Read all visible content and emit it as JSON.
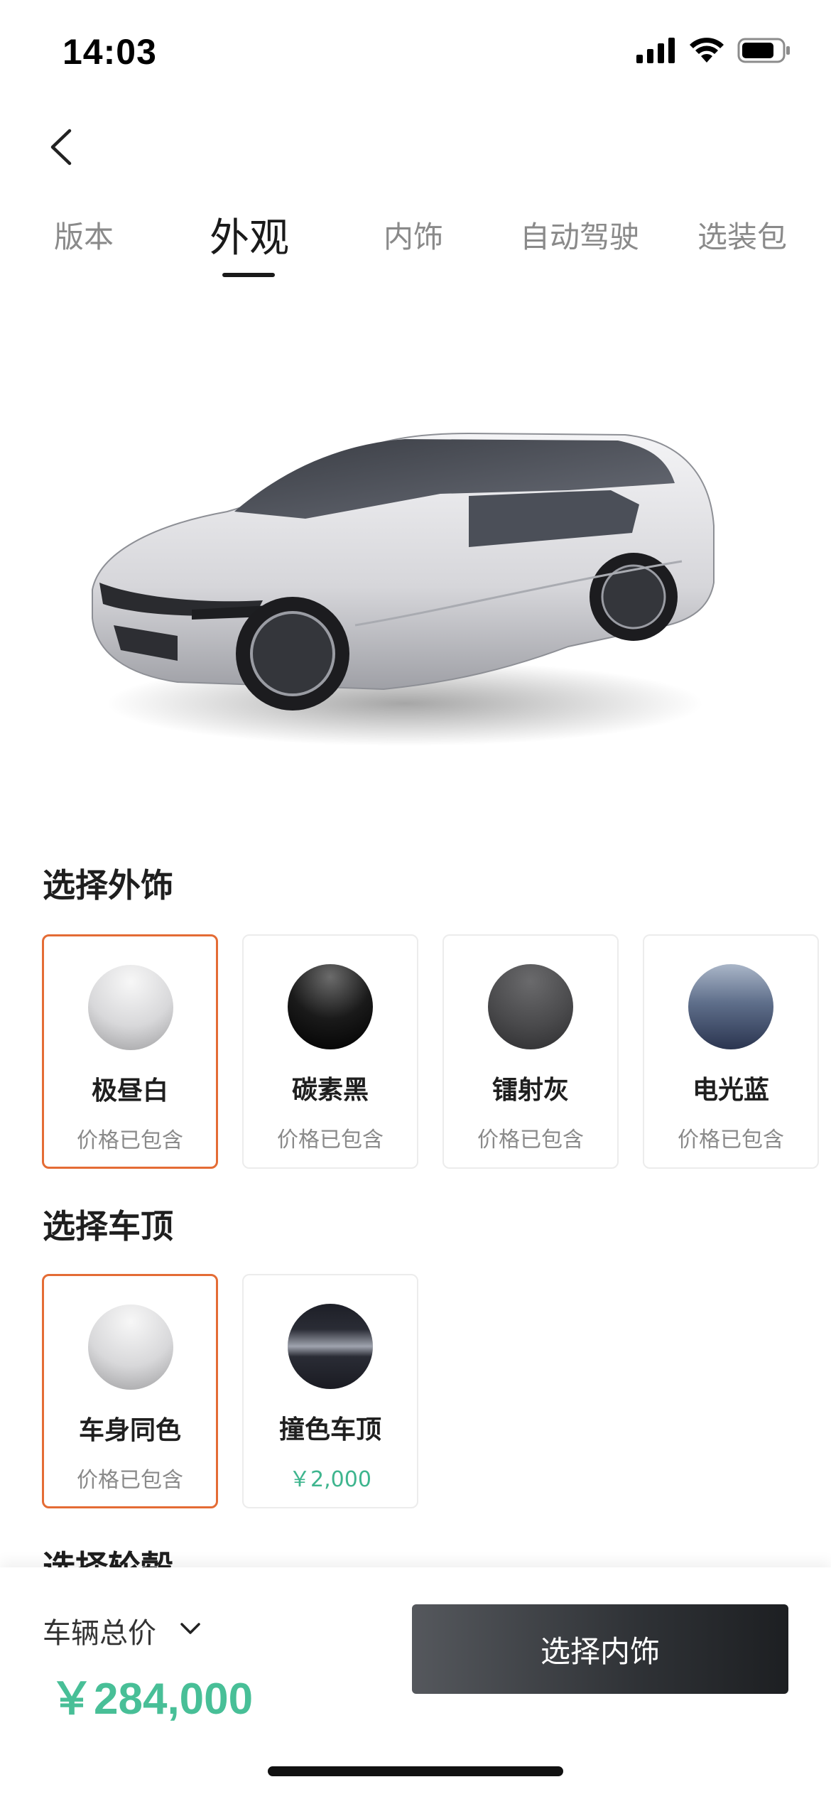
{
  "status_bar": {
    "time": "14:03"
  },
  "tabs": [
    {
      "label": "版本",
      "active": false
    },
    {
      "label": "外观",
      "active": true
    },
    {
      "label": "内饰",
      "active": false
    },
    {
      "label": "自动驾驶",
      "active": false
    },
    {
      "label": "选装包",
      "active": false
    }
  ],
  "exterior": {
    "title": "选择外饰",
    "options": [
      {
        "name": "极昼白",
        "price": "价格已包含",
        "selected": true,
        "color": "#d8d8da"
      },
      {
        "name": "碳素黑",
        "price": "价格已包含",
        "selected": false,
        "color": "#111111"
      },
      {
        "name": "镭射灰",
        "price": "价格已包含",
        "selected": false,
        "color": "#4a4a4c"
      },
      {
        "name": "电光蓝",
        "price": "价格已包含",
        "selected": false,
        "color": "#3f4e6b"
      }
    ]
  },
  "roof": {
    "title": "选择车顶",
    "options": [
      {
        "name": "车身同色",
        "price": "价格已包含",
        "selected": true,
        "color": "#d8d8da"
      },
      {
        "name": "撞色车顶",
        "price": "￥2,000",
        "selected": false,
        "color": "#2a2c35"
      }
    ]
  },
  "wheels": {
    "title": "选择轮毂"
  },
  "bottom": {
    "total_label": "车辆总价",
    "total_price": "￥284,000",
    "next_button": "选择内饰"
  },
  "colors": {
    "accent_selected": "#e46c35",
    "price_green": "#48bf97"
  }
}
